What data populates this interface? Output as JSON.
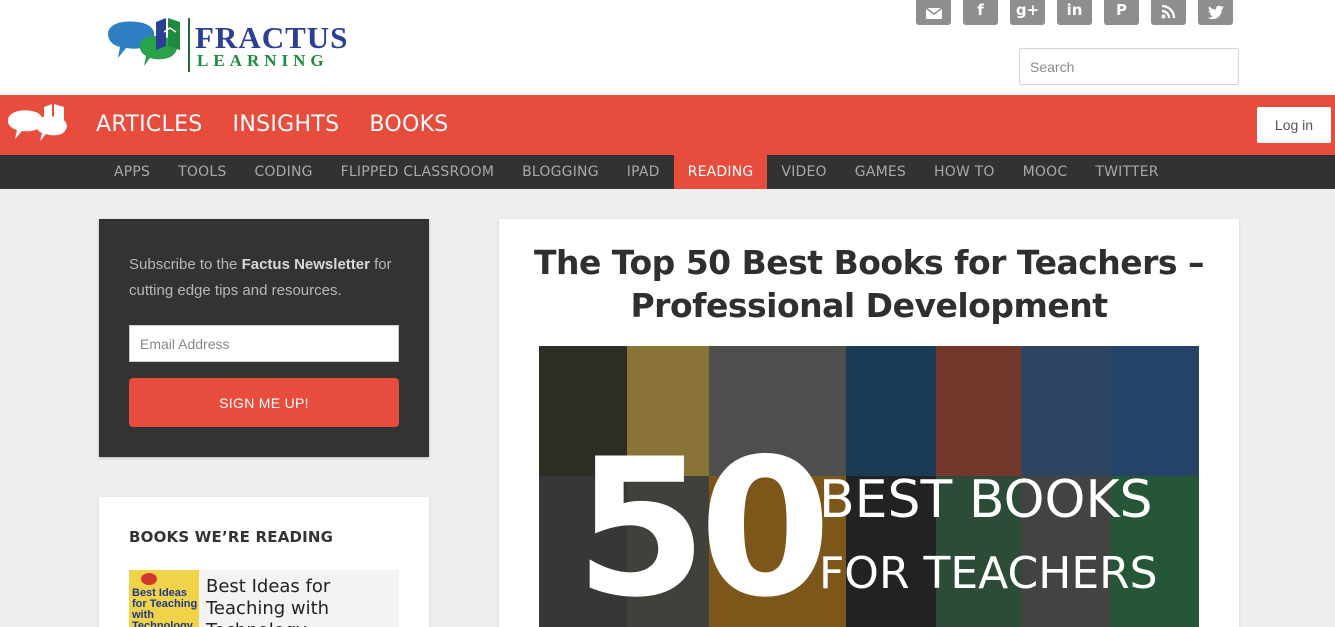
{
  "brand": {
    "name_line1": "FRACTUS",
    "name_line2": "LEARNING",
    "colors": {
      "accent": "#e74c3c",
      "dark": "#333333",
      "navy": "#2b3f94",
      "green": "#1e8a3e"
    }
  },
  "social": [
    {
      "name": "email",
      "icon": "envelope-icon"
    },
    {
      "name": "facebook",
      "icon": "facebook-icon",
      "glyph": "f"
    },
    {
      "name": "google-plus",
      "icon": "google-plus-icon",
      "glyph": "g+"
    },
    {
      "name": "linkedin",
      "icon": "linkedin-icon",
      "glyph": "in"
    },
    {
      "name": "pinterest",
      "icon": "pinterest-icon",
      "glyph": "P"
    },
    {
      "name": "rss",
      "icon": "rss-icon"
    },
    {
      "name": "twitter",
      "icon": "twitter-icon"
    }
  ],
  "search": {
    "placeholder": "Search",
    "value": ""
  },
  "main_nav": [
    "ARTICLES",
    "INSIGHTS",
    "BOOKS"
  ],
  "login_label": "Log in",
  "sub_nav": {
    "items": [
      "APPS",
      "TOOLS",
      "CODING",
      "FLIPPED CLASSROOM",
      "BLOGGING",
      "IPAD",
      "READING",
      "VIDEO",
      "GAMES",
      "HOW TO",
      "MOOC",
      "TWITTER"
    ],
    "active": "READING"
  },
  "newsletter": {
    "text_before": "Subscribe to the ",
    "text_bold": "Factus Newsletter",
    "text_after": " for cutting edge tips and resources.",
    "email_placeholder": "Email Address",
    "button_label": "SIGN ME UP!"
  },
  "books_widget": {
    "heading": "BOOKS WE’RE READING",
    "item": {
      "cover_text": "Best Ideas for Teaching with Technology",
      "title": "Best Ideas for Teaching with Technology"
    }
  },
  "article": {
    "title": "The Top 50 Best Books for Teachers – Professional Development",
    "hero": {
      "number": "50",
      "line1": "BEST BOOKS",
      "line2": "FOR TEACHERS"
    }
  }
}
